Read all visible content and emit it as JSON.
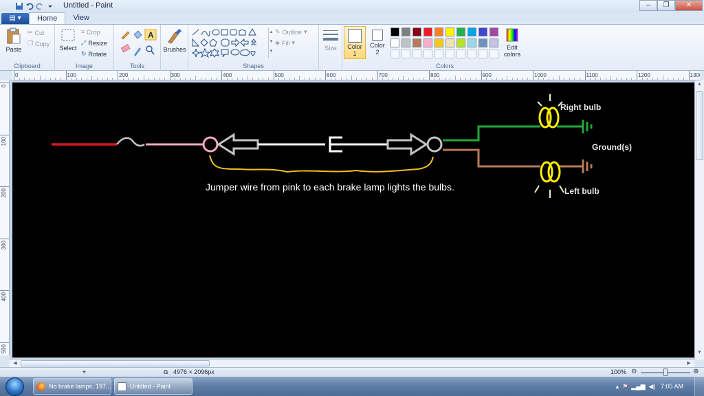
{
  "window": {
    "title": "Untitled - Paint",
    "minimize": "–",
    "maximize": "❐",
    "close": "✕"
  },
  "app_menu": {
    "label": "▤ ▾"
  },
  "tabs": [
    {
      "label": "Home"
    },
    {
      "label": "View"
    }
  ],
  "ribbon": {
    "clipboard": {
      "paste": "Paste",
      "cut": "Cut",
      "copy": "Copy",
      "group": "Clipboard"
    },
    "image": {
      "select": "Select",
      "crop": "Crop",
      "resize": "Resize",
      "rotate": "Rotate",
      "group": "Image"
    },
    "tools": {
      "group": "Tools"
    },
    "brushes": {
      "label": "Brushes"
    },
    "shapes": {
      "outline": "Outline",
      "fill": "Fill",
      "group": "Shapes"
    },
    "size": {
      "label": "Size"
    },
    "color1": {
      "label": "Color 1"
    },
    "color2": {
      "label": "Color 2"
    },
    "colors": {
      "group": "Colors",
      "row1": [
        "#000000",
        "#7f7f7f",
        "#880015",
        "#ed1c24",
        "#ff7f27",
        "#fff200",
        "#22b14c",
        "#00a2e8",
        "#3f48cc",
        "#a349a4"
      ],
      "row2": [
        "#ffffff",
        "#c3c3c3",
        "#b97a57",
        "#ffaec9",
        "#ffc90e",
        "#efe4b0",
        "#b5e61d",
        "#99d9ea",
        "#7092be",
        "#c8bfe7"
      ]
    },
    "edit_colors": "Edit colors"
  },
  "ruler": {
    "h": [
      "0",
      "100",
      "200",
      "300",
      "400",
      "500",
      "600",
      "700",
      "800",
      "900",
      "1000",
      "1100",
      "1200",
      "1300"
    ],
    "v": [
      "0",
      "100",
      "200",
      "300",
      "400",
      "500"
    ]
  },
  "diagram": {
    "caption": "Jumper wire from pink to each brake lamp lights the bulbs.",
    "right_bulb": "Right bulb",
    "left_bulb": "Left bulb",
    "grounds": "Ground(s)",
    "colors": {
      "red": "#d21b1b",
      "pink": "#f4a9c0",
      "white": "#ffffff",
      "yellow": "#f0c020",
      "green": "#22a83a",
      "brown": "#b97a57",
      "bulb": "#ffee00",
      "grey": "#c3c3c3"
    }
  },
  "status": {
    "image_size": "4976 × 2096px",
    "zoom": "100%"
  },
  "taskbar": {
    "items": [
      {
        "label": "No brake lamps, 197..."
      },
      {
        "label": "Untitled - Paint"
      }
    ],
    "clock": "7:05 AM"
  }
}
